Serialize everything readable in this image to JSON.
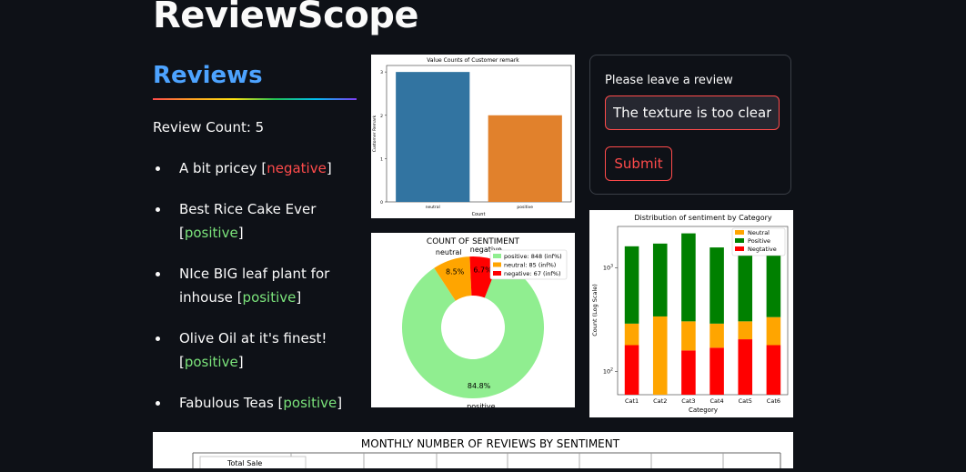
{
  "app": {
    "title": "ReviewScope"
  },
  "reviews": {
    "heading": "Reviews",
    "count_text": "Review Count: 5",
    "items": [
      {
        "text": "A bit pricey",
        "sentiment": "negative"
      },
      {
        "text": "Best Rice Cake Ever",
        "sentiment": "positive"
      },
      {
        "text": "NIce BIG leaf plant for inhouse",
        "sentiment": "positive"
      },
      {
        "text": "Olive Oil at it's finest!",
        "sentiment": "positive"
      },
      {
        "text": "Fabulous Teas",
        "sentiment": "positive"
      }
    ]
  },
  "review_form": {
    "label": "Please leave a review",
    "input_value": "The texture is too clear",
    "submit_label": "Submit"
  },
  "colors": {
    "background": "#0e1117",
    "accent": "#ff4b4b",
    "heading_blue": "#4da3ff",
    "positive_text": "#7be37b"
  },
  "chart_data": [
    {
      "type": "bar",
      "title": "Value Counts of Customer remark",
      "xlabel": "Count",
      "ylabel": "Customer Remark",
      "categories": [
        "neutral",
        "positive"
      ],
      "values": [
        3,
        2
      ],
      "colors": [
        "#3274a1",
        "#e1812c"
      ],
      "ylim": [
        0,
        3.15
      ],
      "yticks": [
        "0",
        "1",
        "2",
        "3"
      ],
      "grid": false
    },
    {
      "type": "pie",
      "title": "COUNT OF SENTIMENT",
      "donut": true,
      "labels": [
        "positive",
        "neutral",
        "negative"
      ],
      "values": [
        848,
        85,
        67
      ],
      "percent_labels": [
        "84.8%",
        "8.5%",
        "6.7%"
      ],
      "legend": [
        "positive: 848 (inf%)",
        "neutral: 85 (inf%)",
        "negative: 67 (inf%)"
      ],
      "colors": [
        "#90ee90",
        "#ffa500",
        "#ff0000"
      ],
      "legend_position": "top-right"
    },
    {
      "type": "bar",
      "stacked": true,
      "log_scale": true,
      "title": "Distribution of sentiment by Category",
      "xlabel": "Category",
      "ylabel": "Count (Log Scale)",
      "categories": [
        "Cat1",
        "Cat2",
        "Cat3",
        "Cat4",
        "Cat5",
        "Cat6"
      ],
      "series": [
        {
          "name": "Negtative",
          "color": "#ff0000",
          "values": [
            120,
            0,
            100,
            110,
            145,
            120
          ]
        },
        {
          "name": "Neutral",
          "color": "#ffa500",
          "values": [
            110,
            280,
            145,
            120,
            100,
            155
          ]
        },
        {
          "name": "Positive",
          "color": "#008000",
          "values": [
            1320,
            1370,
            1840,
            1280,
            1230,
            1245
          ]
        }
      ],
      "legend_order": [
        "Neutral",
        "Positive",
        "Negtative"
      ],
      "yticks": [
        "10^2",
        "10^3"
      ],
      "ylim": [
        60,
        2500
      ],
      "legend_position": "top-right"
    },
    {
      "type": "table",
      "title": "MONTHLY NUMBER OF REVIEWS BY SENTIMENT",
      "header_fragment": "Total Sale"
    }
  ]
}
